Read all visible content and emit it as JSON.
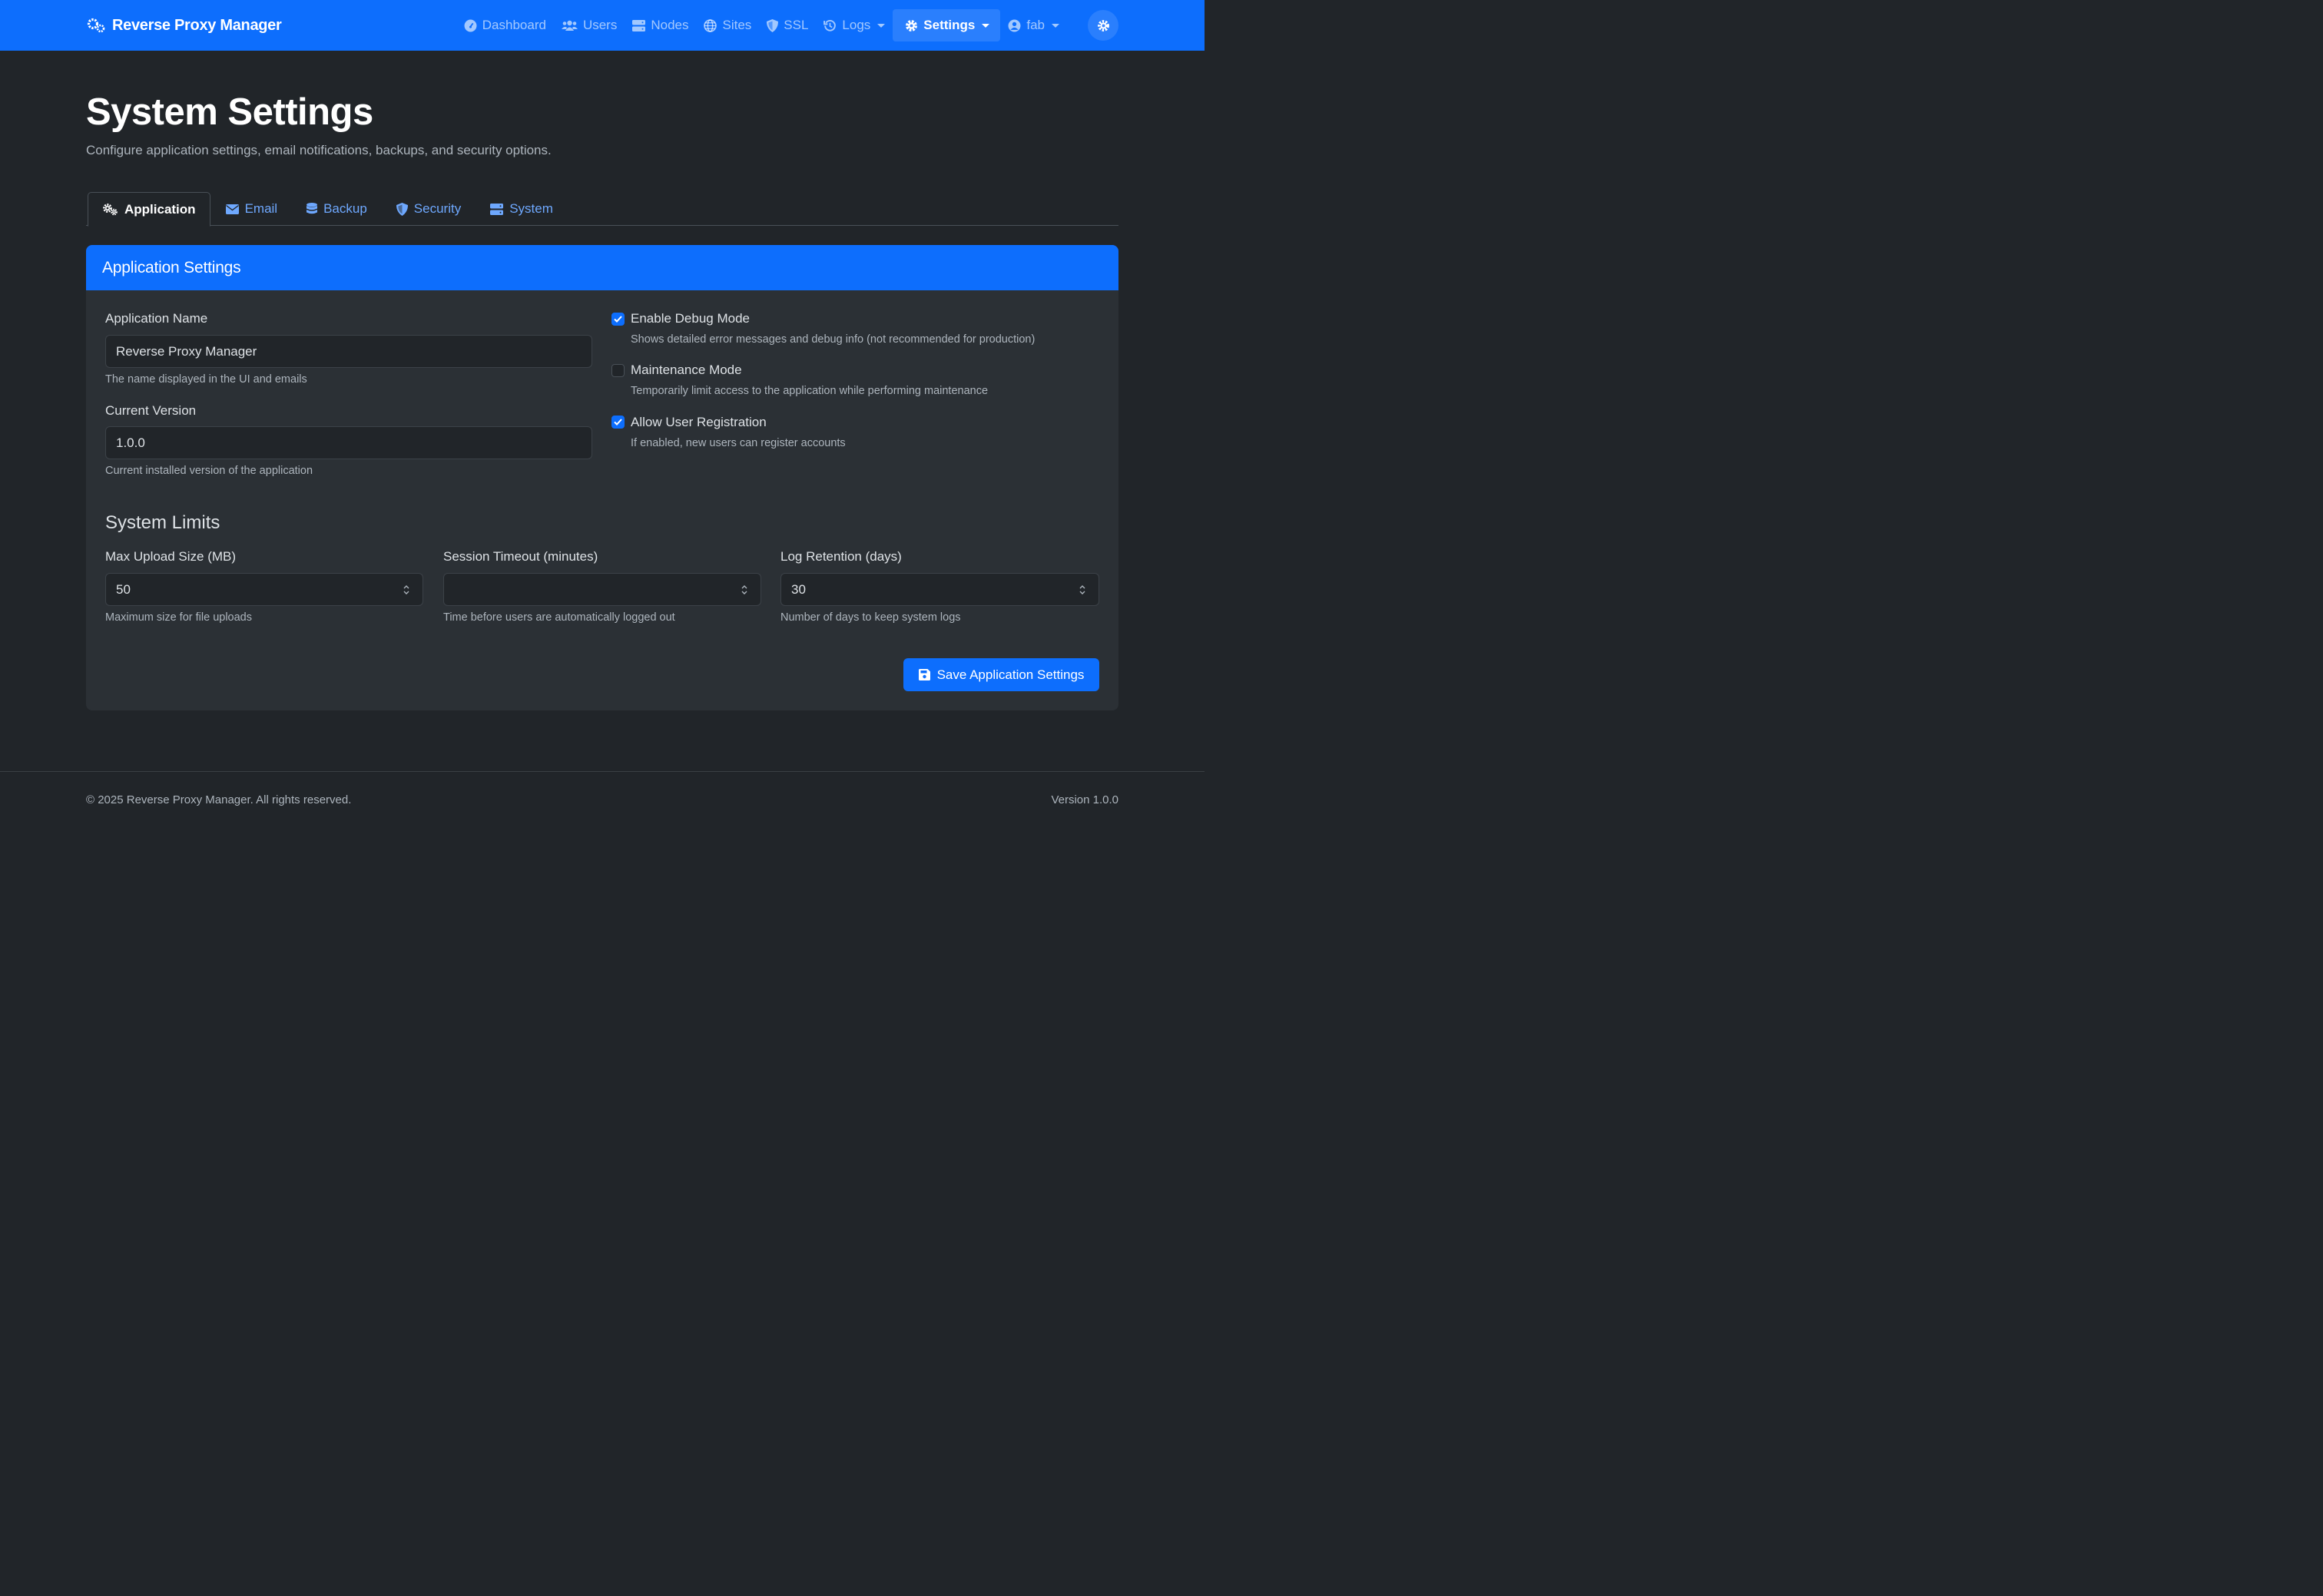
{
  "navbar": {
    "brand": "Reverse Proxy Manager",
    "items": [
      {
        "label": "Dashboard",
        "icon": "gauge-icon"
      },
      {
        "label": "Users",
        "icon": "users-icon"
      },
      {
        "label": "Nodes",
        "icon": "server-icon"
      },
      {
        "label": "Sites",
        "icon": "globe-icon"
      },
      {
        "label": "SSL",
        "icon": "shield-icon"
      },
      {
        "label": "Logs",
        "icon": "history-icon"
      },
      {
        "label": "Settings",
        "icon": "gear-icon"
      },
      {
        "label": "fab",
        "icon": "user-circle-icon"
      }
    ],
    "theme_toggle_icon": "sun-icon"
  },
  "header": {
    "title": "System Settings",
    "subtitle": "Configure application settings, email notifications, backups, and security options."
  },
  "tabs": [
    {
      "label": "Application",
      "icon": "gears-icon",
      "active": true
    },
    {
      "label": "Email",
      "icon": "envelope-icon"
    },
    {
      "label": "Backup",
      "icon": "database-icon"
    },
    {
      "label": "Security",
      "icon": "shield-icon"
    },
    {
      "label": "System",
      "icon": "server-icon"
    }
  ],
  "card": {
    "header": "Application Settings",
    "app_name": {
      "label": "Application Name",
      "value": "Reverse Proxy Manager",
      "help": "The name displayed in the UI and emails"
    },
    "version": {
      "label": "Current Version",
      "value": "1.0.0",
      "help": "Current installed version of the application"
    },
    "toggles": [
      {
        "label": "Enable Debug Mode",
        "help": "Shows detailed error messages and debug info (not recommended for production)",
        "checked": true
      },
      {
        "label": "Maintenance Mode",
        "help": "Temporarily limit access to the application while performing maintenance",
        "checked": false
      },
      {
        "label": "Allow User Registration",
        "help": "If enabled, new users can register accounts",
        "checked": true
      }
    ],
    "limits_title": "System Limits",
    "limits": [
      {
        "label": "Max Upload Size (MB)",
        "value": "50",
        "help": "Maximum size for file uploads"
      },
      {
        "label": "Session Timeout (minutes)",
        "value": "",
        "help": "Time before users are automatically logged out"
      },
      {
        "label": "Log Retention (days)",
        "value": "30",
        "help": "Number of days to keep system logs"
      }
    ],
    "save_label": "Save Application Settings"
  },
  "footer": {
    "copyright": "© 2025 Reverse Proxy Manager. All rights reserved.",
    "version": "Version 1.0.0"
  },
  "colors": {
    "primary": "#0d6efd",
    "background": "#212529",
    "card": "#2b3035",
    "link": "#6ea8fe"
  }
}
